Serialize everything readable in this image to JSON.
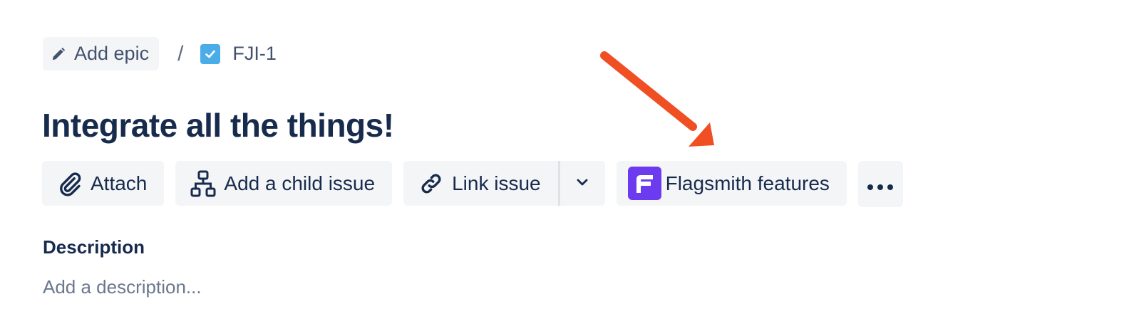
{
  "breadcrumb": {
    "add_epic_label": "Add epic",
    "separator": "/",
    "issue_key": "FJI-1"
  },
  "issue": {
    "title": "Integrate all the things!"
  },
  "toolbar": {
    "attach_label": "Attach",
    "add_child_label": "Add a child issue",
    "link_issue_label": "Link issue",
    "flagsmith_label": "Flagsmith features"
  },
  "description": {
    "heading": "Description",
    "placeholder": "Add a description..."
  },
  "icons": {
    "add_epic": "pencil-icon",
    "issue_type": "checkbox-icon",
    "attach": "paperclip-icon",
    "add_child": "hierarchy-icon",
    "link": "link-icon",
    "dropdown": "chevron-down-icon",
    "flagsmith": "flagsmith-logo-icon",
    "more": "more-icon",
    "annotation": "arrow-icon"
  },
  "colors": {
    "text_primary": "#172b4d",
    "text_secondary": "#42526e",
    "placeholder": "#6b778c",
    "button_bg": "#f4f5f7",
    "task_icon": "#4bade8",
    "flagsmith_brand": "#6c3aef",
    "annotation_arrow": "#f04e23"
  }
}
